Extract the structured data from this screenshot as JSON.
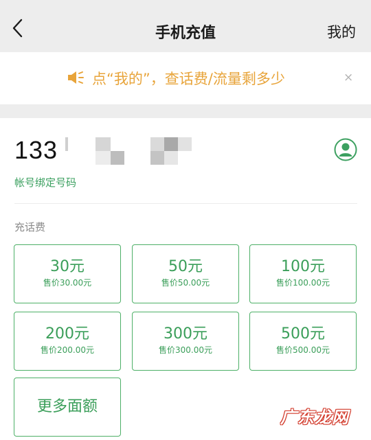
{
  "nav": {
    "title": "手机充值",
    "right_label": "我的"
  },
  "notice": {
    "text": "点“我的”，查话费/流量剩多少",
    "close": "×"
  },
  "account": {
    "phone_visible": "133",
    "bind_label": "帐号绑定号码"
  },
  "section": {
    "label": "充话费"
  },
  "options": [
    {
      "amount": "30元",
      "price": "售价30.00元"
    },
    {
      "amount": "50元",
      "price": "售价50.00元"
    },
    {
      "amount": "100元",
      "price": "售价100.00元"
    },
    {
      "amount": "200元",
      "price": "售价200.00元"
    },
    {
      "amount": "300元",
      "price": "售价300.00元"
    },
    {
      "amount": "500元",
      "price": "售价500.00元"
    }
  ],
  "more": {
    "label": "更多面额"
  },
  "watermark": {
    "text": "广东龙网"
  },
  "colors": {
    "accent": "#3a9e59",
    "notice": "#e8a43a",
    "background": "#ededed"
  },
  "icons": {
    "back": "chevron-left-icon",
    "speaker": "speaker-icon",
    "contact": "contact-icon",
    "close": "close-icon"
  }
}
